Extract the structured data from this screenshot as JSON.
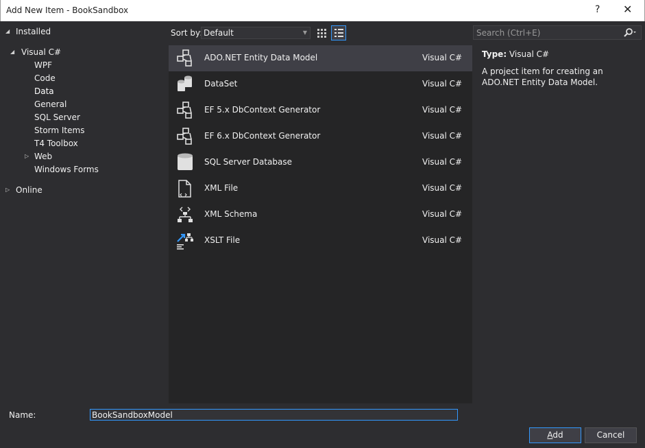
{
  "window": {
    "title": "Add New Item - BookSandbox",
    "help_glyph": "?",
    "close_glyph": "✕"
  },
  "tree": {
    "installed": "Installed",
    "visual_csharp": "Visual C#",
    "children": [
      "WPF",
      "Code",
      "Data",
      "General",
      "SQL Server",
      "Storm Items",
      "T4 Toolbox",
      "Web",
      "Windows Forms"
    ],
    "online": "Online",
    "selected": "Data"
  },
  "toolbar": {
    "sort_label": "Sort by:",
    "sort_value": "Default"
  },
  "items": [
    {
      "name": "ADO.NET Entity Data Model",
      "lang": "Visual C#",
      "icon": "entity-model-icon",
      "selected": true
    },
    {
      "name": "DataSet",
      "lang": "Visual C#",
      "icon": "dataset-icon"
    },
    {
      "name": "EF 5.x DbContext Generator",
      "lang": "Visual C#",
      "icon": "entity-model-icon"
    },
    {
      "name": "EF 6.x DbContext Generator",
      "lang": "Visual C#",
      "icon": "entity-model-icon"
    },
    {
      "name": "SQL Server Database",
      "lang": "Visual C#",
      "icon": "database-icon"
    },
    {
      "name": "XML File",
      "lang": "Visual C#",
      "icon": "xml-file-icon"
    },
    {
      "name": "XML Schema",
      "lang": "Visual C#",
      "icon": "xml-schema-icon"
    },
    {
      "name": "XSLT File",
      "lang": "Visual C#",
      "icon": "xslt-file-icon"
    }
  ],
  "search": {
    "placeholder": "Search (Ctrl+E)"
  },
  "details": {
    "type_label": "Type:",
    "type_value": "Visual C#",
    "description": "A project item for creating an ADO.NET Entity Data Model."
  },
  "bottom": {
    "name_label": "Name:",
    "name_value": "BookSandboxModel",
    "add_label_access": "A",
    "add_label_rest": "dd",
    "cancel_label": "Cancel"
  },
  "colors": {
    "background": "#2d2d30",
    "list_background": "#252526",
    "selected_row": "#3f3f46",
    "accent": "#3399ff",
    "text": "#f1f1f1"
  }
}
